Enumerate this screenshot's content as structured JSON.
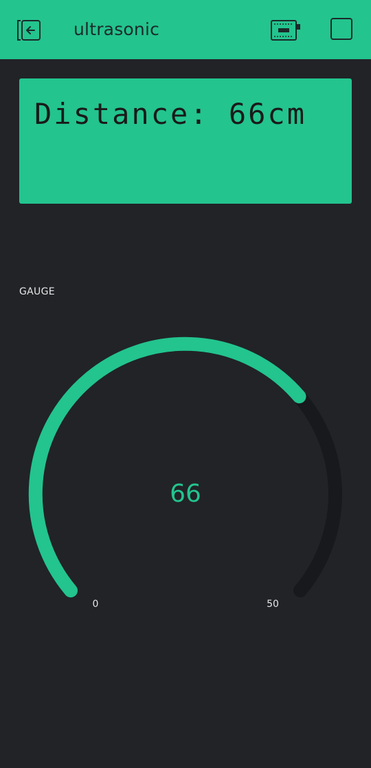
{
  "header": {
    "title": "ultrasonic",
    "back_icon": "exit-project-icon",
    "device_icon": "device-status-icon",
    "square_button_icon": "play-stop-icon"
  },
  "lcd": {
    "line1": "Distance: 66cm",
    "line2": ""
  },
  "gauge": {
    "label": "GAUGE",
    "value": "66",
    "min": "0",
    "max": "50",
    "fill_fraction": 0.69
  },
  "colors": {
    "accent": "#23c48e",
    "background": "#212327",
    "track": "#17191c",
    "text_light": "#e6e6e6"
  }
}
